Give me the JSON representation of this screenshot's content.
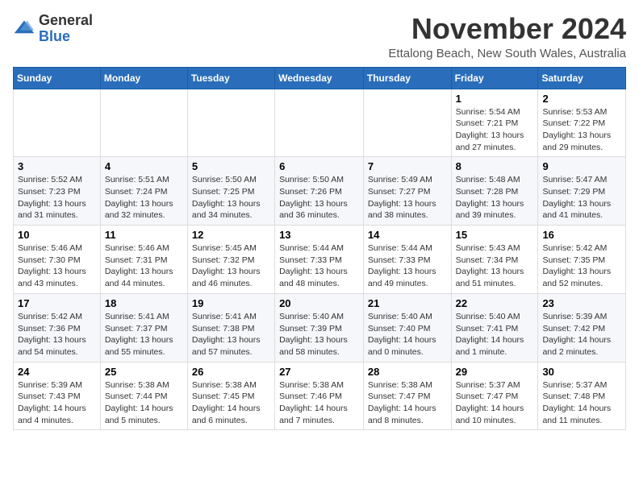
{
  "logo": {
    "general": "General",
    "blue": "Blue"
  },
  "header": {
    "month_title": "November 2024",
    "location": "Ettalong Beach, New South Wales, Australia"
  },
  "weekdays": [
    "Sunday",
    "Monday",
    "Tuesday",
    "Wednesday",
    "Thursday",
    "Friday",
    "Saturday"
  ],
  "weeks": [
    [
      {
        "day": "",
        "info": ""
      },
      {
        "day": "",
        "info": ""
      },
      {
        "day": "",
        "info": ""
      },
      {
        "day": "",
        "info": ""
      },
      {
        "day": "",
        "info": ""
      },
      {
        "day": "1",
        "info": "Sunrise: 5:54 AM\nSunset: 7:21 PM\nDaylight: 13 hours and 27 minutes."
      },
      {
        "day": "2",
        "info": "Sunrise: 5:53 AM\nSunset: 7:22 PM\nDaylight: 13 hours and 29 minutes."
      }
    ],
    [
      {
        "day": "3",
        "info": "Sunrise: 5:52 AM\nSunset: 7:23 PM\nDaylight: 13 hours and 31 minutes."
      },
      {
        "day": "4",
        "info": "Sunrise: 5:51 AM\nSunset: 7:24 PM\nDaylight: 13 hours and 32 minutes."
      },
      {
        "day": "5",
        "info": "Sunrise: 5:50 AM\nSunset: 7:25 PM\nDaylight: 13 hours and 34 minutes."
      },
      {
        "day": "6",
        "info": "Sunrise: 5:50 AM\nSunset: 7:26 PM\nDaylight: 13 hours and 36 minutes."
      },
      {
        "day": "7",
        "info": "Sunrise: 5:49 AM\nSunset: 7:27 PM\nDaylight: 13 hours and 38 minutes."
      },
      {
        "day": "8",
        "info": "Sunrise: 5:48 AM\nSunset: 7:28 PM\nDaylight: 13 hours and 39 minutes."
      },
      {
        "day": "9",
        "info": "Sunrise: 5:47 AM\nSunset: 7:29 PM\nDaylight: 13 hours and 41 minutes."
      }
    ],
    [
      {
        "day": "10",
        "info": "Sunrise: 5:46 AM\nSunset: 7:30 PM\nDaylight: 13 hours and 43 minutes."
      },
      {
        "day": "11",
        "info": "Sunrise: 5:46 AM\nSunset: 7:31 PM\nDaylight: 13 hours and 44 minutes."
      },
      {
        "day": "12",
        "info": "Sunrise: 5:45 AM\nSunset: 7:32 PM\nDaylight: 13 hours and 46 minutes."
      },
      {
        "day": "13",
        "info": "Sunrise: 5:44 AM\nSunset: 7:33 PM\nDaylight: 13 hours and 48 minutes."
      },
      {
        "day": "14",
        "info": "Sunrise: 5:44 AM\nSunset: 7:33 PM\nDaylight: 13 hours and 49 minutes."
      },
      {
        "day": "15",
        "info": "Sunrise: 5:43 AM\nSunset: 7:34 PM\nDaylight: 13 hours and 51 minutes."
      },
      {
        "day": "16",
        "info": "Sunrise: 5:42 AM\nSunset: 7:35 PM\nDaylight: 13 hours and 52 minutes."
      }
    ],
    [
      {
        "day": "17",
        "info": "Sunrise: 5:42 AM\nSunset: 7:36 PM\nDaylight: 13 hours and 54 minutes."
      },
      {
        "day": "18",
        "info": "Sunrise: 5:41 AM\nSunset: 7:37 PM\nDaylight: 13 hours and 55 minutes."
      },
      {
        "day": "19",
        "info": "Sunrise: 5:41 AM\nSunset: 7:38 PM\nDaylight: 13 hours and 57 minutes."
      },
      {
        "day": "20",
        "info": "Sunrise: 5:40 AM\nSunset: 7:39 PM\nDaylight: 13 hours and 58 minutes."
      },
      {
        "day": "21",
        "info": "Sunrise: 5:40 AM\nSunset: 7:40 PM\nDaylight: 14 hours and 0 minutes."
      },
      {
        "day": "22",
        "info": "Sunrise: 5:40 AM\nSunset: 7:41 PM\nDaylight: 14 hours and 1 minute."
      },
      {
        "day": "23",
        "info": "Sunrise: 5:39 AM\nSunset: 7:42 PM\nDaylight: 14 hours and 2 minutes."
      }
    ],
    [
      {
        "day": "24",
        "info": "Sunrise: 5:39 AM\nSunset: 7:43 PM\nDaylight: 14 hours and 4 minutes."
      },
      {
        "day": "25",
        "info": "Sunrise: 5:38 AM\nSunset: 7:44 PM\nDaylight: 14 hours and 5 minutes."
      },
      {
        "day": "26",
        "info": "Sunrise: 5:38 AM\nSunset: 7:45 PM\nDaylight: 14 hours and 6 minutes."
      },
      {
        "day": "27",
        "info": "Sunrise: 5:38 AM\nSunset: 7:46 PM\nDaylight: 14 hours and 7 minutes."
      },
      {
        "day": "28",
        "info": "Sunrise: 5:38 AM\nSunset: 7:47 PM\nDaylight: 14 hours and 8 minutes."
      },
      {
        "day": "29",
        "info": "Sunrise: 5:37 AM\nSunset: 7:47 PM\nDaylight: 14 hours and 10 minutes."
      },
      {
        "day": "30",
        "info": "Sunrise: 5:37 AM\nSunset: 7:48 PM\nDaylight: 14 hours and 11 minutes."
      }
    ]
  ]
}
